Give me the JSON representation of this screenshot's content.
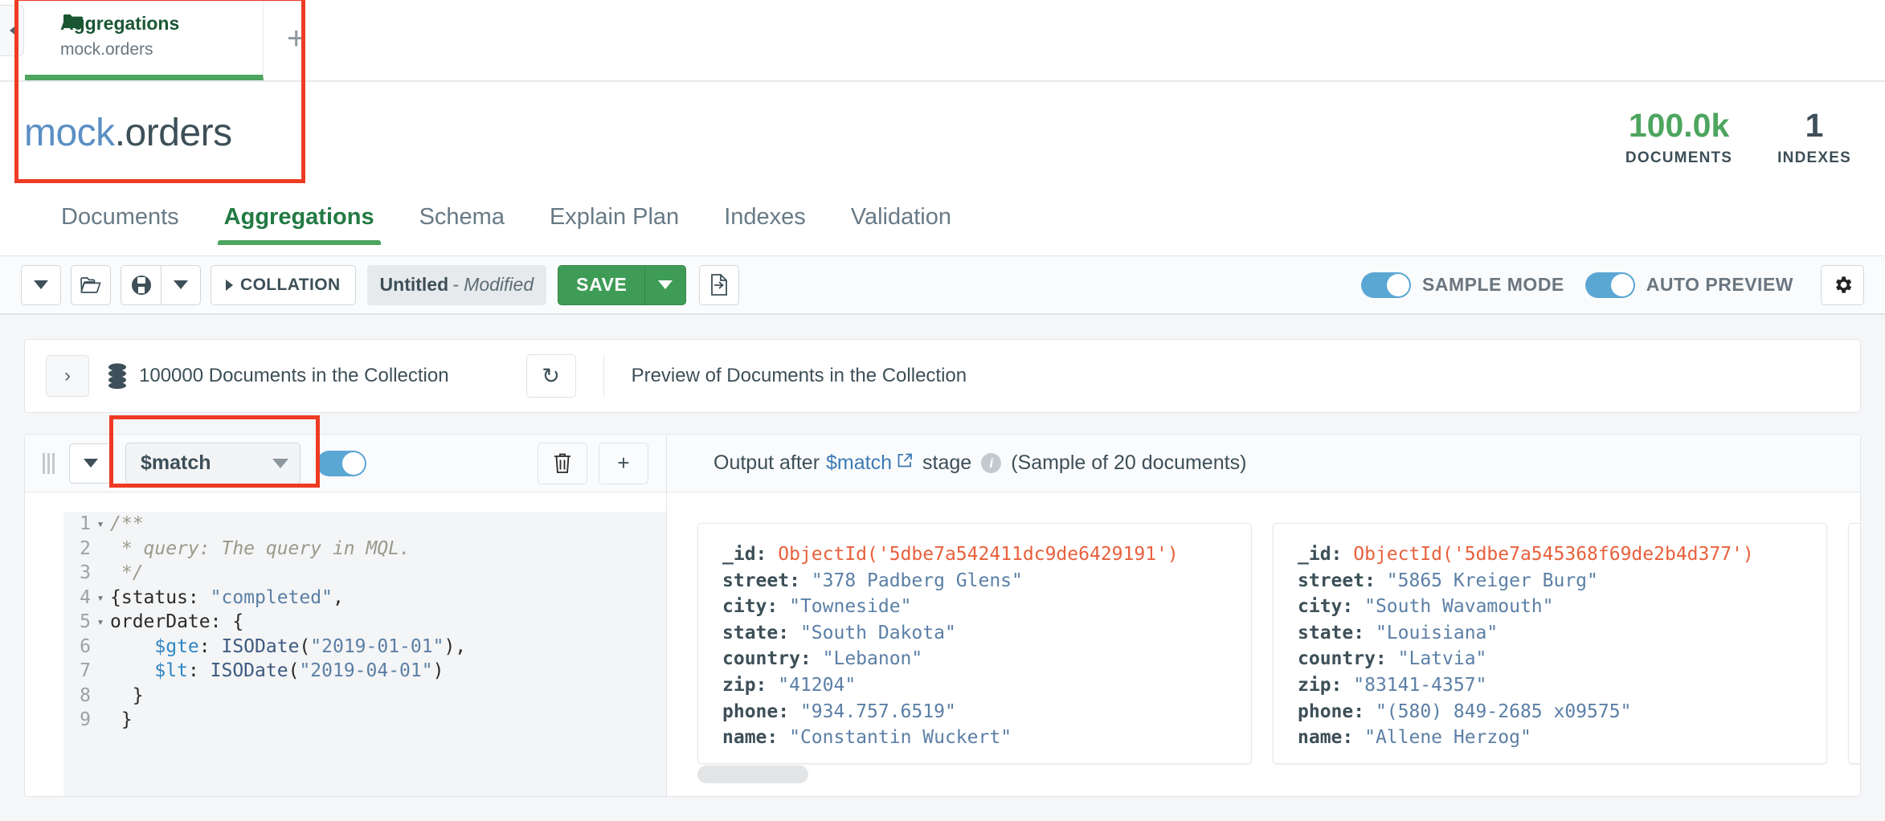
{
  "tab": {
    "title": "Aggregations",
    "subtitle": "mock.orders",
    "new_tab_glyph": "+",
    "folder_icon": "folder-icon"
  },
  "collection": {
    "db": "mock",
    "dot_name": ".orders",
    "stats": [
      {
        "value": "100.0k",
        "label": "DOCUMENTS",
        "color": "#4da55f"
      },
      {
        "value": "1",
        "label": "INDEXES",
        "color": "#3d4f58"
      }
    ]
  },
  "nav_tabs": [
    {
      "label": "Documents",
      "active": false
    },
    {
      "label": "Aggregations",
      "active": true
    },
    {
      "label": "Schema",
      "active": false
    },
    {
      "label": "Explain Plan",
      "active": false
    },
    {
      "label": "Indexes",
      "active": false
    },
    {
      "label": "Validation",
      "active": false
    }
  ],
  "toolbar": {
    "chevron_btn": "v",
    "open_folder_icon": "folder-open-icon",
    "save_pipeline_icon": "save-disk-icon",
    "save_pipeline_caret": "chevron-down-icon",
    "collation_label": "COLLATION",
    "pipeline_name": "Untitled",
    "pipeline_state": "- Modified",
    "save_label": "SAVE",
    "save_caret": "chevron-down-icon",
    "export_icon": "export-pipeline-icon",
    "sample_mode_label": "SAMPLE MODE",
    "sample_mode_on": true,
    "auto_preview_label": "AUTO PREVIEW",
    "auto_preview_on": true,
    "settings_icon": "gear-icon"
  },
  "collection_preview": {
    "expand_glyph": "›",
    "count_text": "100000 Documents in the Collection",
    "refresh_glyph": "↻",
    "preview_label": "Preview of Documents in the Collection"
  },
  "stage": {
    "collapse_glyph": "v",
    "operator": "$match",
    "enabled": true,
    "delete_icon": "trash-icon",
    "add_icon": "plus-icon",
    "code_lines": [
      {
        "n": "1",
        "fold": "▾",
        "tokens": [
          {
            "t": "/**",
            "c": "cm"
          }
        ]
      },
      {
        "n": "2",
        "fold": "",
        "tokens": [
          {
            "t": " * query: The query in MQL.",
            "c": "cm"
          }
        ]
      },
      {
        "n": "3",
        "fold": "",
        "tokens": [
          {
            "t": " */",
            "c": "cm"
          }
        ]
      },
      {
        "n": "4",
        "fold": "▾",
        "tokens": [
          {
            "t": "{status: ",
            "c": "pn"
          },
          {
            "t": "\"completed\"",
            "c": "str"
          },
          {
            "t": ",",
            "c": "pn"
          }
        ]
      },
      {
        "n": "5",
        "fold": "▾",
        "tokens": [
          {
            "t": "orderDate: {",
            "c": "pn"
          }
        ]
      },
      {
        "n": "6",
        "fold": "",
        "tokens": [
          {
            "t": "    ",
            "c": "pn"
          },
          {
            "t": "$gte",
            "c": "kw"
          },
          {
            "t": ": ",
            "c": "pn"
          },
          {
            "t": "ISODate",
            "c": "fn"
          },
          {
            "t": "(",
            "c": "pn"
          },
          {
            "t": "\"2019-01-01\"",
            "c": "str"
          },
          {
            "t": "),",
            "c": "pn"
          }
        ]
      },
      {
        "n": "7",
        "fold": "",
        "tokens": [
          {
            "t": "    ",
            "c": "pn"
          },
          {
            "t": "$lt",
            "c": "kw"
          },
          {
            "t": ": ",
            "c": "pn"
          },
          {
            "t": "ISODate",
            "c": "fn"
          },
          {
            "t": "(",
            "c": "pn"
          },
          {
            "t": "\"2019-04-01\"",
            "c": "str"
          },
          {
            "t": ")",
            "c": "pn"
          }
        ]
      },
      {
        "n": "8",
        "fold": "",
        "tokens": [
          {
            "t": "  }",
            "c": "pn"
          }
        ]
      },
      {
        "n": "9",
        "fold": "",
        "tokens": [
          {
            "t": " }",
            "c": "pn"
          }
        ]
      }
    ]
  },
  "output": {
    "prefix": "Output after",
    "stage_link": "$match",
    "ext_icon": "external-link-icon",
    "suffix": "stage",
    "info_icon": "info-icon",
    "sample_note": "(Sample of 20 documents)",
    "documents": [
      {
        "fields": [
          {
            "key": "_id",
            "value": "ObjectId('5dbe7a542411dc9de6429191')",
            "type": "oid"
          },
          {
            "key": "street",
            "value": "\"378 Padberg Glens\"",
            "type": "sv"
          },
          {
            "key": "city",
            "value": "\"Towneside\"",
            "type": "sv"
          },
          {
            "key": "state",
            "value": "\"South Dakota\"",
            "type": "sv"
          },
          {
            "key": "country",
            "value": "\"Lebanon\"",
            "type": "sv"
          },
          {
            "key": "zip",
            "value": "\"41204\"",
            "type": "sv"
          },
          {
            "key": "phone",
            "value": "\"934.757.6519\"",
            "type": "sv"
          },
          {
            "key": "name",
            "value": "\"Constantin Wuckert\"",
            "type": "sv"
          }
        ]
      },
      {
        "fields": [
          {
            "key": "_id",
            "value": "ObjectId('5dbe7a545368f69de2b4d377')",
            "type": "oid"
          },
          {
            "key": "street",
            "value": "\"5865 Kreiger Burg\"",
            "type": "sv"
          },
          {
            "key": "city",
            "value": "\"South Wavamouth\"",
            "type": "sv"
          },
          {
            "key": "state",
            "value": "\"Louisiana\"",
            "type": "sv"
          },
          {
            "key": "country",
            "value": "\"Latvia\"",
            "type": "sv"
          },
          {
            "key": "zip",
            "value": "\"83141-4357\"",
            "type": "sv"
          },
          {
            "key": "phone",
            "value": "\"(580) 849-2685 x09575\"",
            "type": "sv"
          },
          {
            "key": "name",
            "value": "\"Allene Herzog\"",
            "type": "sv"
          }
        ]
      },
      {
        "fields": []
      }
    ]
  },
  "annotations": {
    "colors": {
      "highlight": "#ee3b23",
      "accent_green": "#4da55f",
      "toggle_blue": "#5aa7d4",
      "link_blue": "#3b7ab5"
    }
  }
}
